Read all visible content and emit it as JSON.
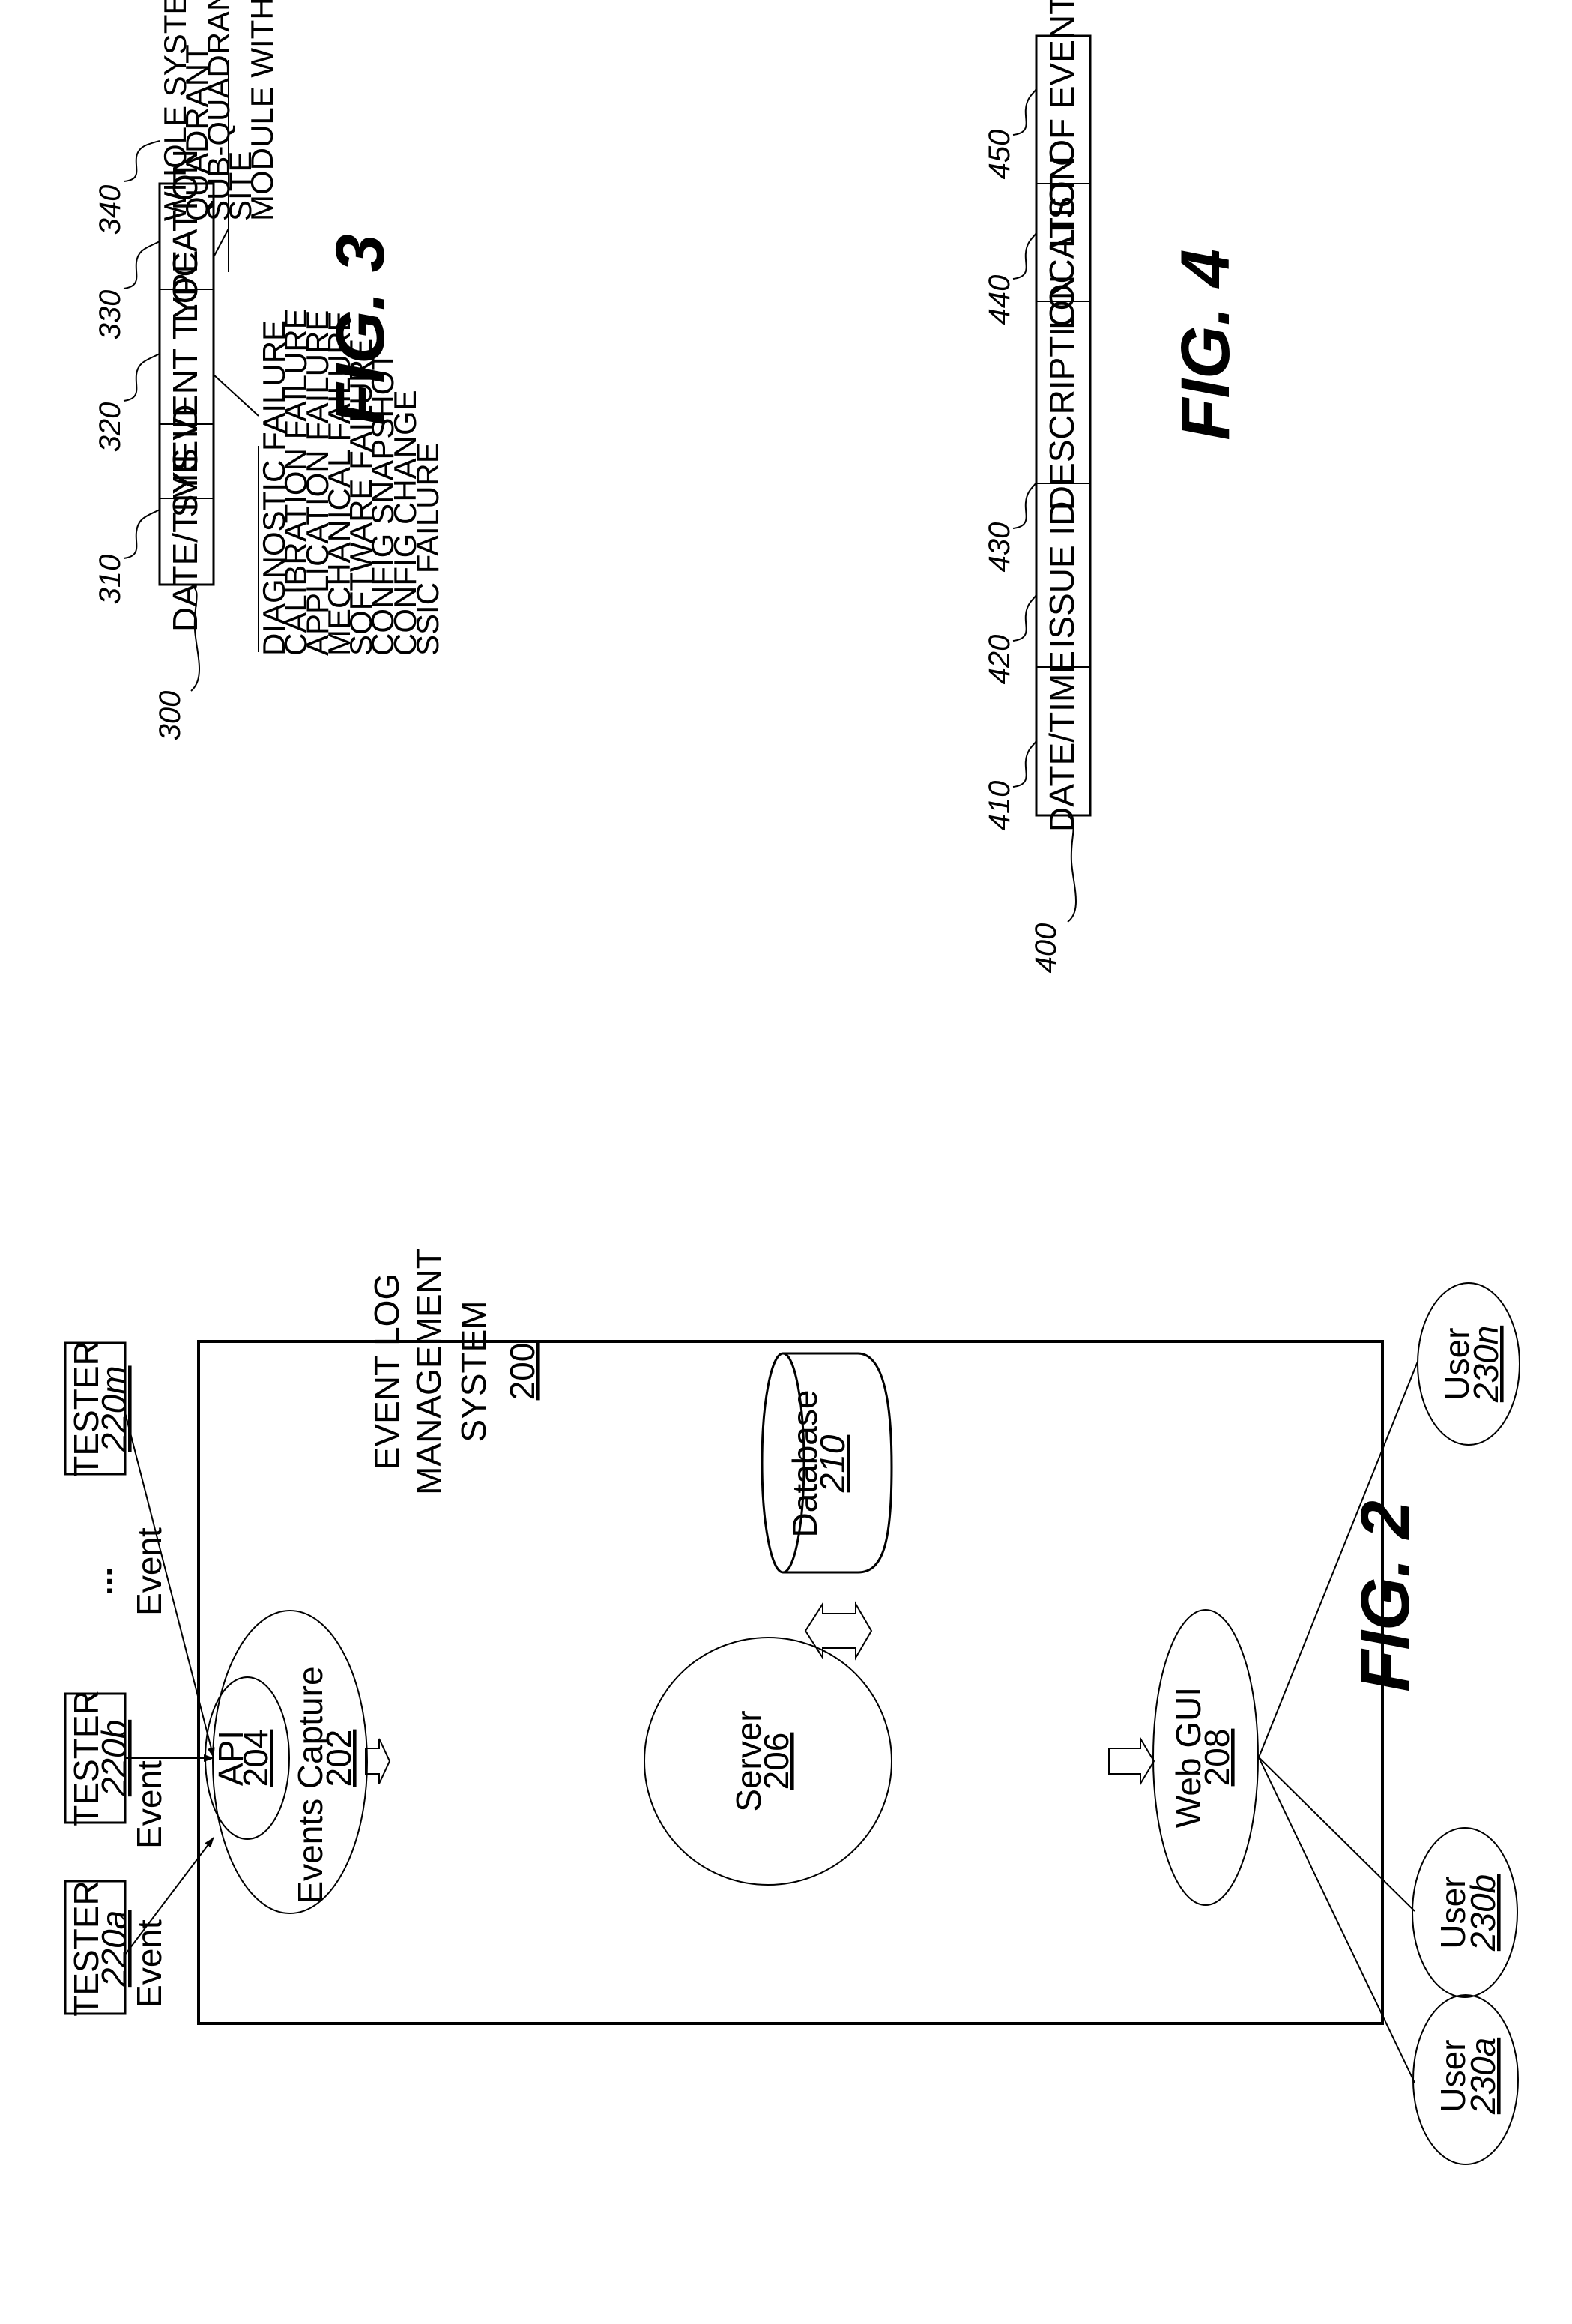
{
  "fig2": {
    "caption": "FIG. 2",
    "system": {
      "line1": "EVENT LOG",
      "line2": "MANAGEMENT",
      "line3": "SYSTEM",
      "ref": "200"
    },
    "testers": [
      {
        "label": "TESTER",
        "ref": "220a"
      },
      {
        "label": "TESTER",
        "ref": "220b"
      },
      {
        "label": "TESTER",
        "ref": "220m"
      }
    ],
    "ellipsis": "...",
    "event_labels": [
      "Event",
      "Event",
      "Event"
    ],
    "events_capture": {
      "label": "Events Capture",
      "ref": "202"
    },
    "api": {
      "label": "API",
      "ref": "204"
    },
    "server": {
      "label": "Server",
      "ref": "206"
    },
    "web_gui": {
      "label": "Web GUI",
      "ref": "208"
    },
    "database": {
      "label": "Database",
      "ref": "210"
    },
    "users": [
      {
        "label": "User",
        "ref": "230a"
      },
      {
        "label": "User",
        "ref": "230b"
      },
      {
        "label": "User",
        "ref": "230n"
      }
    ]
  },
  "fig3": {
    "caption": "FIG. 3",
    "record_ref": "300",
    "fields": [
      {
        "label": "DATE/TIME",
        "ref": "310"
      },
      {
        "label": "SYS ID",
        "ref": "320"
      },
      {
        "label": "EVENT TYPE",
        "ref": "330"
      },
      {
        "label": "LOCATION",
        "ref": "340"
      }
    ],
    "event_types": [
      "DIAGNOSTIC FAILURE",
      "CALIBRATION FAILURE",
      "APPLICATION FAILURE",
      "MECHANICAL FAILURE",
      "SOFTWARE FAILURE",
      "CONFIG SNAPSHOT",
      "CONFIG CHANGE",
      "SSIC FAILURE"
    ],
    "locations": [
      "WHOLE SYSTEM",
      "QUADRANT",
      "SUB-QUADRANT",
      "SITE",
      "MODULE WITHIN SITE"
    ]
  },
  "fig4": {
    "caption": "FIG. 4",
    "record_ref": "400",
    "fields": [
      {
        "label": "DATE/TIME",
        "ref": "410"
      },
      {
        "label": "ISSUE ID",
        "ref": "420"
      },
      {
        "label": "DESCRIPTION",
        "ref": "430"
      },
      {
        "label": "LOCATION",
        "ref": "440"
      },
      {
        "label": "LIST OF EVENTS",
        "ref": "450"
      }
    ]
  }
}
